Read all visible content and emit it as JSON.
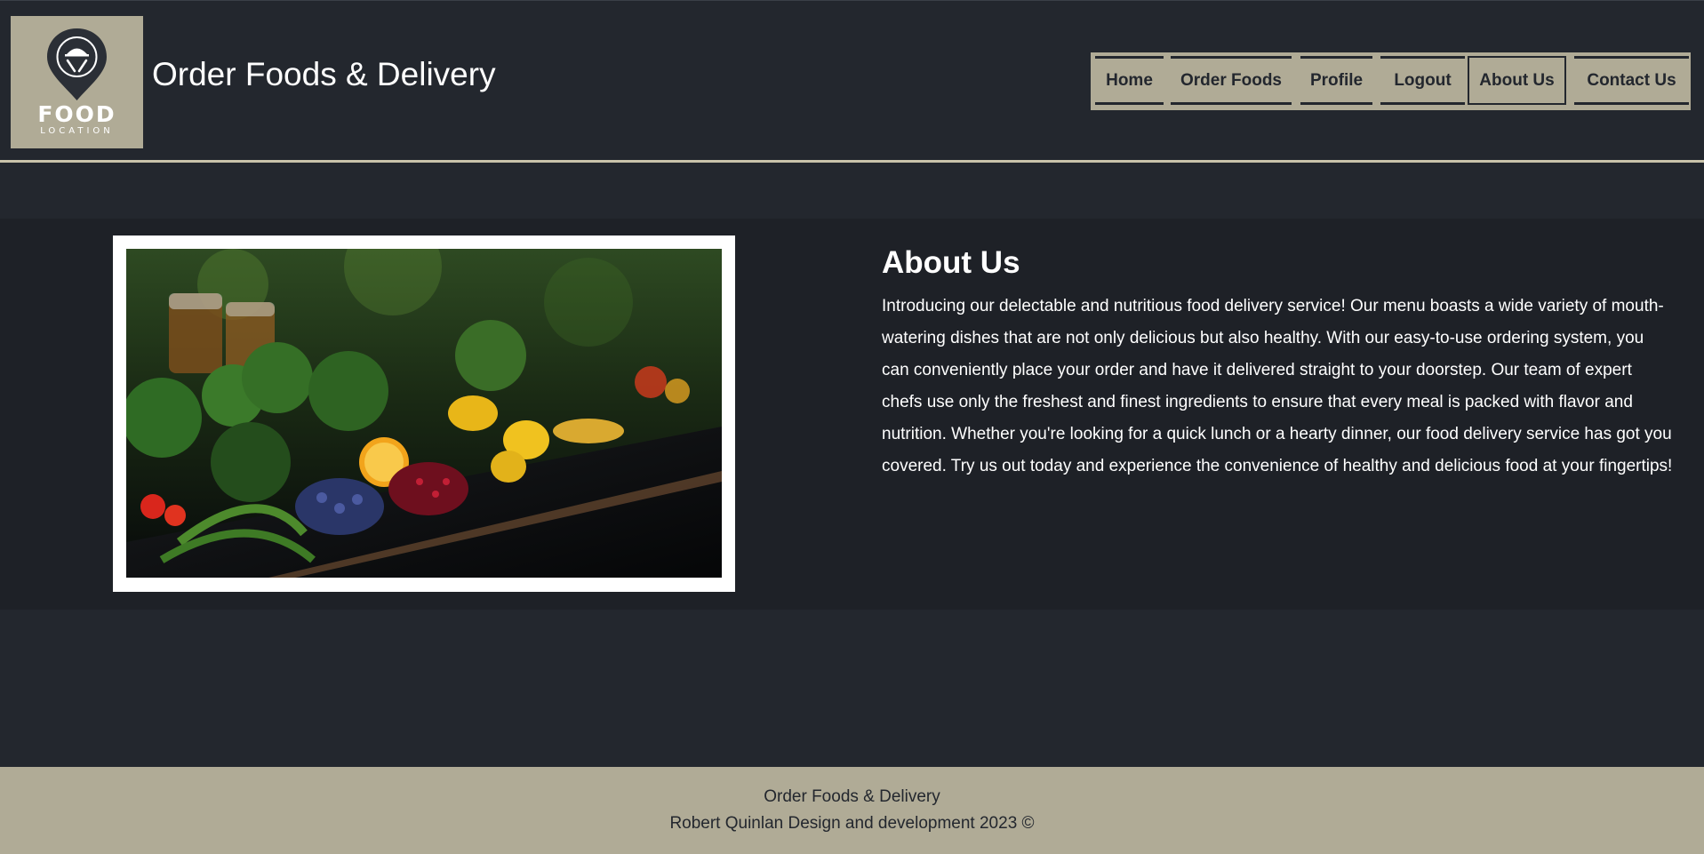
{
  "header": {
    "logo": {
      "word": "FOOD",
      "sub": "LOCATION"
    },
    "title": "Order Foods & Delivery"
  },
  "nav": {
    "items": [
      {
        "label": "Home"
      },
      {
        "label": "Order Foods"
      },
      {
        "label": "Profile"
      },
      {
        "label": "Logout"
      },
      {
        "label": "About Us"
      },
      {
        "label": "Contact Us"
      }
    ],
    "active": "About Us"
  },
  "about": {
    "title": "About Us",
    "text": "Introducing our delectable and nutritious food delivery service! Our menu boasts a wide variety of mouth-watering dishes that are not only delicious but also healthy. With our easy-to-use ordering system, you can conveniently place your order and have it delivered straight to your doorstep. Our team of expert chefs use only the freshest and finest ingredients to ensure that every meal is packed with flavor and nutrition. Whether you're looking for a quick lunch or a hearty dinner, our food delivery service has got you covered. Try us out today and experience the convenience of healthy and delicious food at your fingertips!"
  },
  "footer": {
    "line1": "Order Foods & Delivery",
    "line2": "Robert Quinlan Design and development 2023 ©"
  },
  "colors": {
    "background": "#23272e",
    "band": "#1e2127",
    "accent": "#b0ab96",
    "text": "#ffffff"
  },
  "icons": {
    "logo": "map-pin-food-icon"
  }
}
